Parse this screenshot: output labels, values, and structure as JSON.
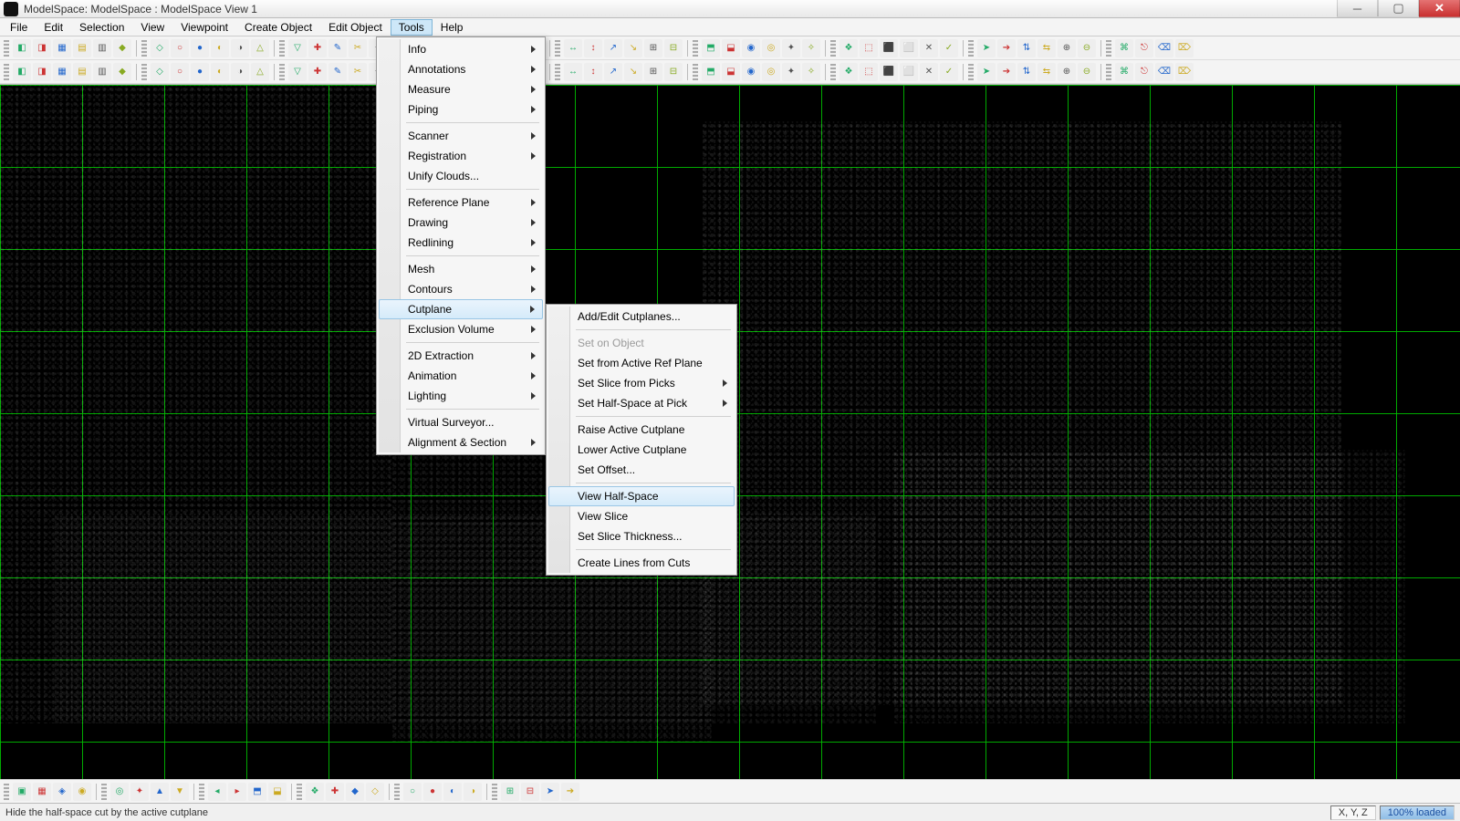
{
  "window": {
    "title": "ModelSpace: ModelSpace  : ModelSpace  View 1"
  },
  "menubar": [
    "File",
    "Edit",
    "Selection",
    "View",
    "Viewpoint",
    "Create Object",
    "Edit Object",
    "Tools",
    "Help"
  ],
  "active_menu_index": 7,
  "tools_menu": {
    "groups": [
      [
        {
          "label": "Info",
          "submenu": true
        },
        {
          "label": "Annotations",
          "submenu": true
        },
        {
          "label": "Measure",
          "submenu": true
        },
        {
          "label": "Piping",
          "submenu": true
        }
      ],
      [
        {
          "label": "Scanner",
          "submenu": true
        },
        {
          "label": "Registration",
          "submenu": true
        },
        {
          "label": "Unify Clouds..."
        }
      ],
      [
        {
          "label": "Reference Plane",
          "submenu": true
        },
        {
          "label": "Drawing",
          "submenu": true
        },
        {
          "label": "Redlining",
          "submenu": true
        }
      ],
      [
        {
          "label": "Mesh",
          "submenu": true
        },
        {
          "label": "Contours",
          "submenu": true
        },
        {
          "label": "Cutplane",
          "submenu": true,
          "hover": true
        },
        {
          "label": "Exclusion Volume",
          "submenu": true
        }
      ],
      [
        {
          "label": "2D Extraction",
          "submenu": true
        },
        {
          "label": "Animation",
          "submenu": true
        },
        {
          "label": "Lighting",
          "submenu": true
        }
      ],
      [
        {
          "label": "Virtual Surveyor..."
        },
        {
          "label": "Alignment & Section",
          "submenu": true
        }
      ]
    ]
  },
  "cutplane_submenu": {
    "groups": [
      [
        {
          "label": "Add/Edit Cutplanes..."
        }
      ],
      [
        {
          "label": "Set on Object",
          "disabled": true
        },
        {
          "label": "Set from Active Ref Plane"
        },
        {
          "label": "Set Slice from Picks",
          "submenu": true
        },
        {
          "label": "Set Half-Space at Pick",
          "submenu": true
        }
      ],
      [
        {
          "label": "Raise Active Cutplane"
        },
        {
          "label": "Lower Active Cutplane"
        },
        {
          "label": "Set Offset..."
        }
      ],
      [
        {
          "label": "View Half-Space",
          "hover": true
        },
        {
          "label": "View Slice"
        },
        {
          "label": "Set Slice Thickness..."
        }
      ],
      [
        {
          "label": "Create Lines from Cuts"
        }
      ]
    ]
  },
  "statusbar": {
    "hint": "Hide the half-space cut by the active cutplane",
    "coords": "X, Y, Z",
    "loaded": "100% loaded"
  },
  "colors": {
    "grid": "#00bb00",
    "axis": "#00ff00",
    "viewport_bg": "#000000",
    "menu_highlight": "#cde7f8"
  }
}
